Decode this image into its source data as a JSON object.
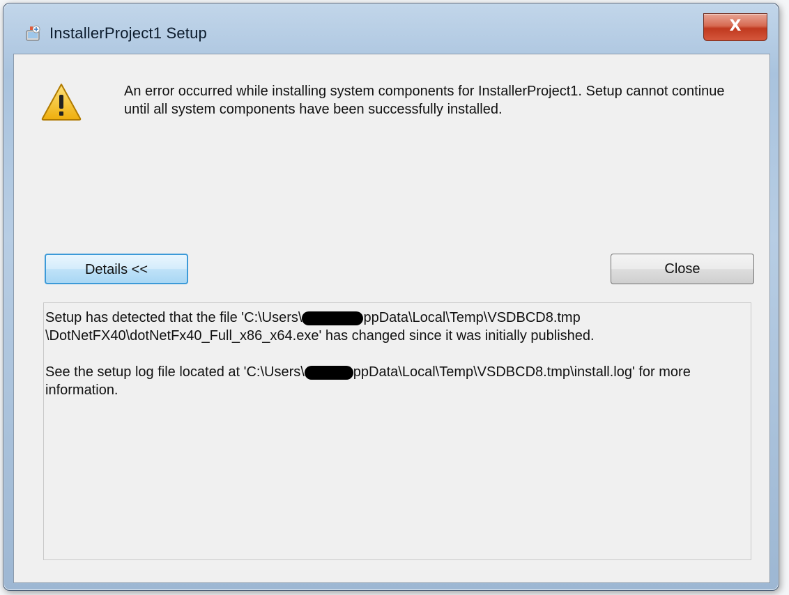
{
  "window": {
    "title": "InstallerProject1 Setup",
    "close_glyph": "X"
  },
  "icons": {
    "app": "installer-app-icon",
    "warning": "warning-triangle-icon"
  },
  "message": {
    "text": "An error occurred while installing system components for InstallerProject1. Setup cannot continue until all system components have been successfully installed."
  },
  "buttons": {
    "details": "Details <<",
    "close": "Close"
  },
  "details": {
    "line1_before": "Setup has detected that the file 'C:\\Users\\",
    "line1_after": "ppData\\Local\\Temp\\VSDBCD8.tmp",
    "line2": "\\DotNetFX40\\dotNetFx40_Full_x86_x64.exe' has changed since it was initially published.",
    "para2_before": "See the setup log file located at 'C:\\Users\\",
    "para2_after": "ppData\\Local\\Temp\\VSDBCD8.tmp\\install.log' for more information."
  },
  "colors": {
    "focus_border": "#3c9ad8",
    "caption_close": "#c0391f",
    "warning_yellow": "#f5c21b"
  }
}
